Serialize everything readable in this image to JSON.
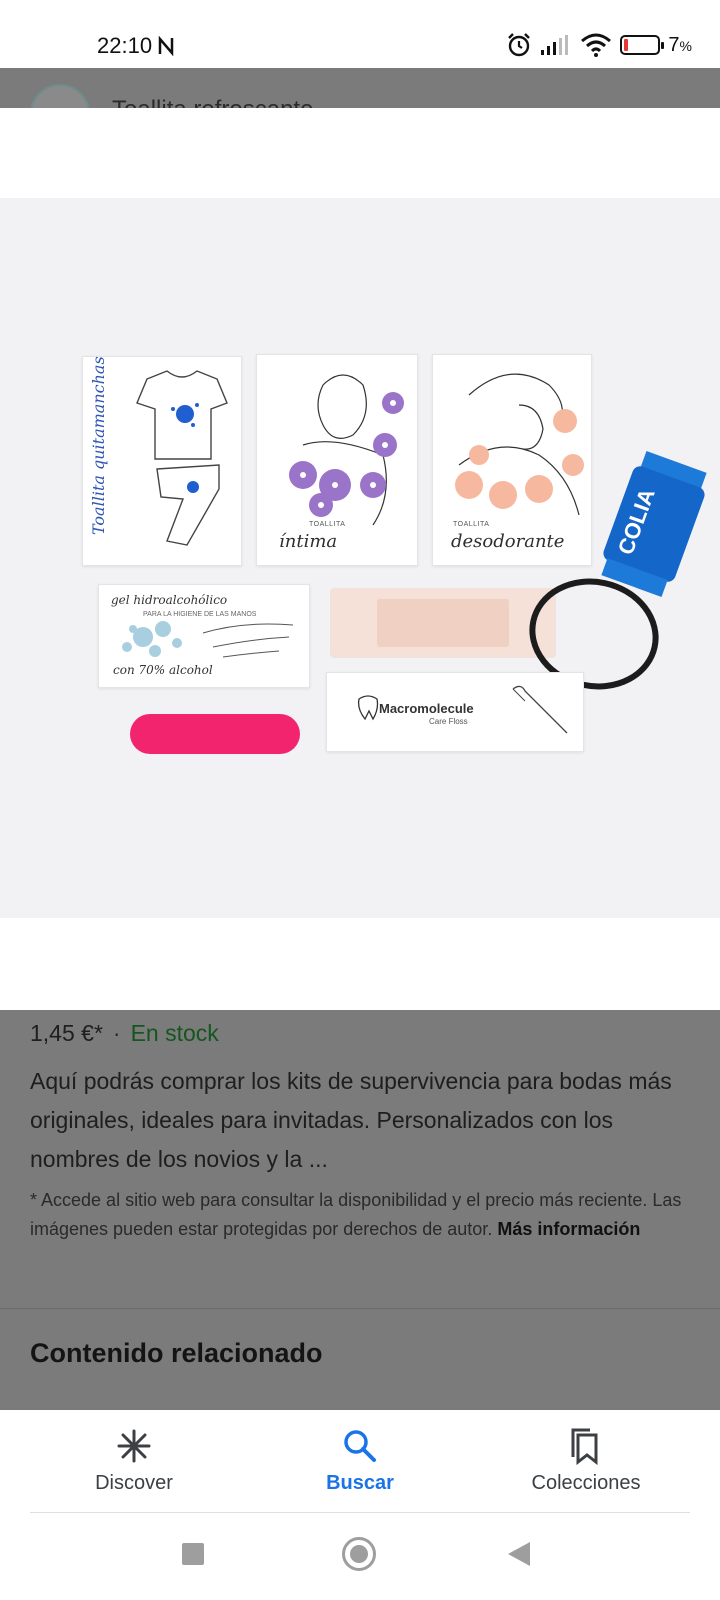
{
  "status_bar": {
    "time": "22:10",
    "battery_percent": "7",
    "battery_suffix": "%"
  },
  "header": {
    "title_partial": "Toallita refrescante"
  },
  "image": {
    "sachets": {
      "stain": "Toallita quitamanchas",
      "intimate_small": "TOALLITA",
      "intimate_label": "íntima",
      "deodorant_small": "TOALLITA",
      "deodorant_label": "desodorante",
      "gel_title": "gel hidroalcohólico",
      "gel_sub": "PARA LA HIGIENE DE LAS MANOS",
      "gel_alcohol": "con 70% alcohol",
      "floss_brand": "Macromolecule",
      "floss_sub": "Care Floss",
      "candy_brand": "COLIA"
    }
  },
  "product": {
    "price": "1,45 €*",
    "separator": "·",
    "stock": "En stock",
    "description": "Aquí podrás comprar los kits de supervivencia para bodas más originales, ideales para invitadas. Personalizados con los nombres de los novios y la ...",
    "disclaimer": "* Accede al sitio web para consultar la disponibilidad y el precio más reciente. Las imágenes pueden estar protegidas por derechos de autor.",
    "more_info": "Más información",
    "related_heading": "Contenido relacionado"
  },
  "bottom_nav": {
    "items": [
      {
        "label": "Discover",
        "icon": "asterisk-icon"
      },
      {
        "label": "Buscar",
        "icon": "search-icon"
      },
      {
        "label": "Colecciones",
        "icon": "bookmarks-icon"
      }
    ],
    "active": "Buscar"
  },
  "colors": {
    "accent": "#1a73e8",
    "stock": "#15561f",
    "scrim": "#7b7b7b"
  }
}
